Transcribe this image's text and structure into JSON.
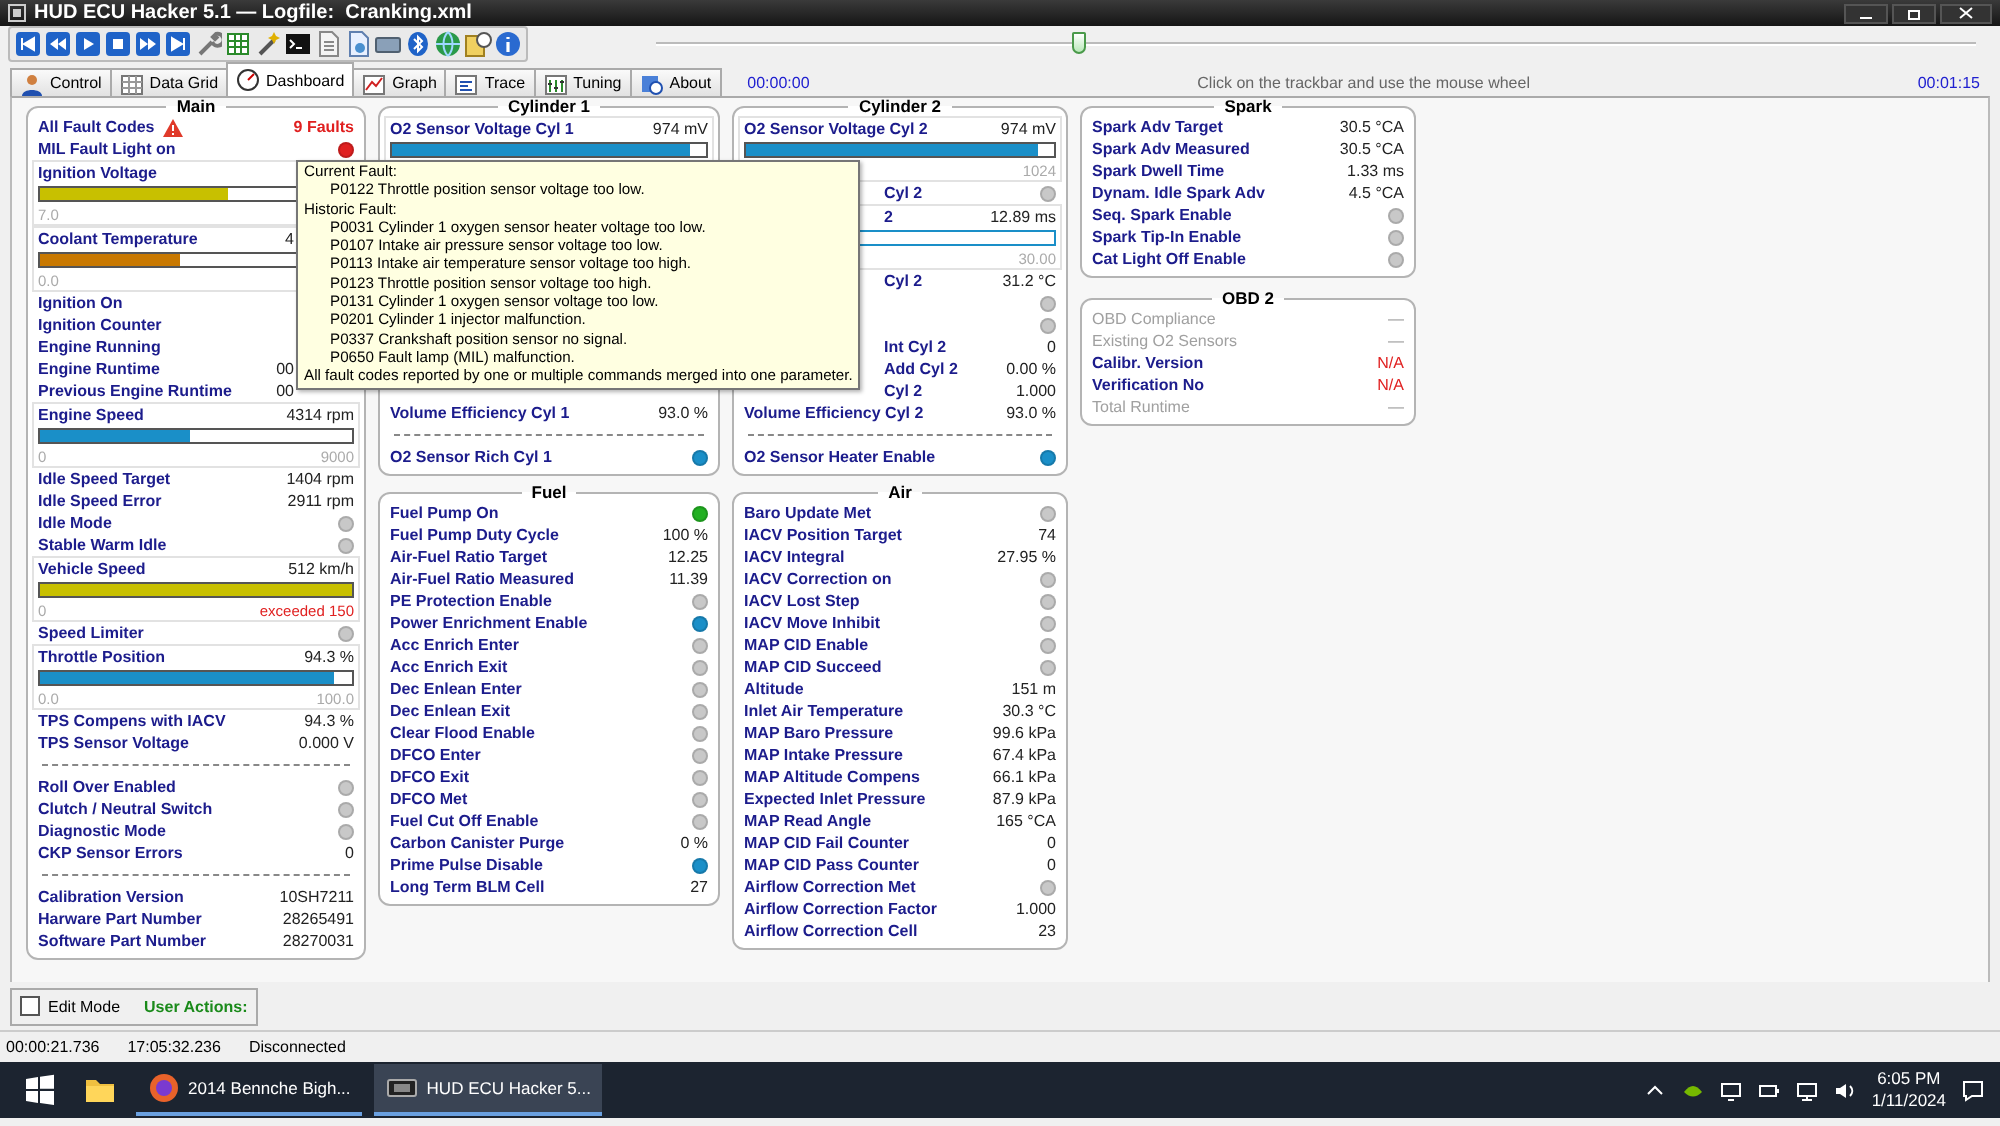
{
  "window": {
    "title": "HUD ECU Hacker 5.1 — Logfile:",
    "logfile": "Cranking.xml"
  },
  "trackbar": {
    "level": 0.32,
    "start": "00:00:00",
    "hint": "Click on the trackbar and use the mouse wheel",
    "end": "00:01:15"
  },
  "tabs": [
    {
      "label": "Control",
      "selected": false
    },
    {
      "label": "Data Grid",
      "selected": false
    },
    {
      "label": "Dashboard",
      "selected": true
    },
    {
      "label": "Graph",
      "selected": false
    },
    {
      "label": "Trace",
      "selected": false
    },
    {
      "label": "Tuning",
      "selected": false
    },
    {
      "label": "About",
      "selected": false
    }
  ],
  "main": {
    "title": "Main",
    "rows": [
      {
        "kind": "fault",
        "label": "All Fault Codes",
        "value": "9 Faults",
        "alert": true
      },
      {
        "kind": "light",
        "label": "MIL Fault Light on",
        "color": "#e02020"
      },
      {
        "kind": "bar",
        "label": "Ignition Voltage",
        "level": 0.6,
        "color": "#c8c000",
        "min": "7.0"
      },
      {
        "kind": "bar",
        "label": "Coolant Temperature",
        "value_head": "4",
        "level": 0.45,
        "color": "#c87800",
        "min": "0.0"
      },
      {
        "kind": "label",
        "label": "Ignition On"
      },
      {
        "kind": "label",
        "label": "Ignition Counter"
      },
      {
        "kind": "label",
        "label": "Engine Running"
      },
      {
        "kind": "value",
        "label": "Engine Runtime",
        "value_head": "00"
      },
      {
        "kind": "value",
        "label": "Previous Engine Runtime",
        "value_head": "00"
      },
      {
        "kind": "bar",
        "label": "Engine Speed",
        "value": "4314 rpm",
        "level": 0.48,
        "color": "#1a8fc8",
        "min": "0",
        "max": "9000"
      },
      {
        "kind": "value",
        "label": "Idle Speed Target",
        "value": "1404 rpm"
      },
      {
        "kind": "value",
        "label": "Idle Speed Error",
        "value": "2911 rpm"
      },
      {
        "kind": "light",
        "label": "Idle Mode",
        "color": "#c8c8c8"
      },
      {
        "kind": "light",
        "label": "Stable Warm Idle",
        "color": "#c8c8c8"
      },
      {
        "kind": "bar",
        "label": "Vehicle Speed",
        "value": "512 km/h",
        "level": 1,
        "color": "#c8c000",
        "min": "0",
        "max": "exceeded 150",
        "max_alert": true
      },
      {
        "kind": "light",
        "label": "Speed Limiter",
        "color": "#c8c8c8"
      },
      {
        "kind": "bar",
        "label": "Throttle Position",
        "value": "94.3 %",
        "level": 0.943,
        "color": "#1a8fc8",
        "min": "0.0",
        "max": "100.0"
      },
      {
        "kind": "value",
        "label": "TPS Compens with IACV",
        "value": "94.3 %"
      },
      {
        "kind": "value",
        "label": "TPS Sensor Voltage",
        "value": "0.000 V"
      },
      {
        "kind": "separator"
      },
      {
        "kind": "light",
        "label": "Roll Over Enabled",
        "color": "#c8c8c8"
      },
      {
        "kind": "light",
        "label": "Clutch / Neutral Switch",
        "color": "#c8c8c8"
      },
      {
        "kind": "light",
        "label": "Diagnostic Mode",
        "color": "#c8c8c8"
      },
      {
        "kind": "value",
        "label": "CKP Sensor Errors",
        "value": "0"
      },
      {
        "kind": "separator"
      },
      {
        "kind": "value",
        "label": "Calibration Version",
        "value": "10SH7211"
      },
      {
        "kind": "value",
        "label": "Harware Part Number",
        "value": "28265491"
      },
      {
        "kind": "value",
        "label": "Software Part Number",
        "value": "28270031"
      }
    ]
  },
  "cylinder_1": {
    "title": "Cylinder 1",
    "rows": [
      {
        "kind": "bar",
        "label": "O2 Sensor Voltage Cyl 1",
        "value": "974 mV",
        "level": 0.95,
        "color": "#1a8fc8"
      },
      {
        "kind": "value",
        "label": "Volume Efficiency Cyl 1",
        "value": "93.0 %"
      },
      {
        "kind": "separator"
      },
      {
        "kind": "light",
        "label": "O2 Sensor Rich Cyl 1",
        "color": "#1a8fc8"
      }
    ]
  },
  "cylinder_2": {
    "title": "Cylinder 2",
    "rows": [
      {
        "kind": "bar",
        "label": "O2 Sensor Voltage Cyl 2",
        "value": "974 mV",
        "level": 0.95,
        "color": "#1a8fc8",
        "max": "1024"
      },
      {
        "kind": "light",
        "label_tail": "Cyl 2",
        "color": "#c8c8c8"
      },
      {
        "kind": "bar",
        "label_tail": "2",
        "value": "12.89 ms",
        "color": "#1a8fc8",
        "max": "30.00"
      },
      {
        "kind": "value",
        "label_tail": "Cyl 2",
        "value": "31.2 °C"
      },
      {
        "kind": "light",
        "color": "#c8c8c8"
      },
      {
        "kind": "light",
        "color": "#c8c8c8"
      },
      {
        "kind": "value",
        "label_tail": "Int Cyl 2",
        "value": "0"
      },
      {
        "kind": "value",
        "label_tail": "Add Cyl 2",
        "value": "0.00 %"
      },
      {
        "kind": "value",
        "label_tail": "Cyl 2",
        "value": "1.000"
      },
      {
        "kind": "value",
        "label": "Volume Efficiency Cyl 2",
        "value": "93.0 %"
      },
      {
        "kind": "separator"
      },
      {
        "kind": "light",
        "label": "O2 Sensor Heater Enable",
        "color": "#1a8fc8"
      }
    ]
  },
  "fuel": {
    "title": "Fuel",
    "rows": [
      {
        "kind": "light",
        "label": "Fuel Pump On",
        "color": "#22b022"
      },
      {
        "kind": "value",
        "label": "Fuel Pump Duty Cycle",
        "value": "100 %"
      },
      {
        "kind": "value",
        "label": "Air-Fuel Ratio Target",
        "value": "12.25"
      },
      {
        "kind": "value",
        "label": "Air-Fuel Ratio Measured",
        "value": "11.39"
      },
      {
        "kind": "light",
        "label": "PE Protection Enable",
        "color": "#c8c8c8"
      },
      {
        "kind": "light",
        "label": "Power Enrichment Enable",
        "color": "#1a8fc8"
      },
      {
        "kind": "light",
        "label": "Acc Enrich Enter",
        "color": "#c8c8c8"
      },
      {
        "kind": "light",
        "label": "Acc Enrich Exit",
        "color": "#c8c8c8"
      },
      {
        "kind": "light",
        "label": "Dec Enlean Enter",
        "color": "#c8c8c8"
      },
      {
        "kind": "light",
        "label": "Dec Enlean Exit",
        "color": "#c8c8c8"
      },
      {
        "kind": "light",
        "label": "Clear Flood Enable",
        "color": "#c8c8c8"
      },
      {
        "kind": "light",
        "label": "DFCO Enter",
        "color": "#c8c8c8"
      },
      {
        "kind": "light",
        "label": "DFCO Exit",
        "color": "#c8c8c8"
      },
      {
        "kind": "light",
        "label": "DFCO Met",
        "color": "#c8c8c8"
      },
      {
        "kind": "light",
        "label": "Fuel Cut Off Enable",
        "color": "#c8c8c8"
      },
      {
        "kind": "value",
        "label": "Carbon Canister Purge",
        "value": "0 %"
      },
      {
        "kind": "light",
        "label": "Prime Pulse Disable",
        "color": "#1a8fc8"
      },
      {
        "kind": "value",
        "label": "Long Term BLM Cell",
        "value": "27"
      }
    ]
  },
  "air": {
    "title": "Air",
    "rows": [
      {
        "kind": "light",
        "label": "Baro Update Met",
        "color": "#c8c8c8"
      },
      {
        "kind": "value",
        "label": "IACV Position Target",
        "value": "74"
      },
      {
        "kind": "value",
        "label": "IACV Integral",
        "value": "27.95 %"
      },
      {
        "kind": "light",
        "label": "IACV Correction on",
        "color": "#c8c8c8"
      },
      {
        "kind": "light",
        "label": "IACV Lost Step",
        "color": "#c8c8c8"
      },
      {
        "kind": "light",
        "label": "IACV Move Inhibit",
        "color": "#c8c8c8"
      },
      {
        "kind": "light",
        "label": "MAP CID Enable",
        "color": "#c8c8c8"
      },
      {
        "kind": "light",
        "label": "MAP CID Succeed",
        "color": "#c8c8c8"
      },
      {
        "kind": "value",
        "label": "Altitude",
        "value": "151 m"
      },
      {
        "kind": "value",
        "label": "Inlet Air Temperature",
        "value": "30.3 °C"
      },
      {
        "kind": "value",
        "label": "MAP Baro Pressure",
        "value": "99.6 kPa"
      },
      {
        "kind": "value",
        "label": "MAP Intake Pressure",
        "value": "67.4 kPa"
      },
      {
        "kind": "value",
        "label": "MAP Altitude Compens",
        "value": "66.1 kPa"
      },
      {
        "kind": "value",
        "label": "Expected Inlet Pressure",
        "value": "87.9 kPa"
      },
      {
        "kind": "value",
        "label": "MAP Read Angle",
        "value": "165 °CA"
      },
      {
        "kind": "value",
        "label": "MAP CID Fail Counter",
        "value": "0"
      },
      {
        "kind": "value",
        "label": "MAP CID Pass Counter",
        "value": "0"
      },
      {
        "kind": "light",
        "label": "Airflow Correction Met",
        "color": "#c8c8c8"
      },
      {
        "kind": "value",
        "label": "Airflow Correction Factor",
        "value": "1.000"
      },
      {
        "kind": "value",
        "label": "Airflow Correction Cell",
        "value": "23"
      }
    ]
  },
  "spark": {
    "title": "Spark",
    "rows": [
      {
        "kind": "value",
        "label": "Spark Adv Target",
        "value": "30.5 °CA"
      },
      {
        "kind": "value",
        "label": "Spark Adv Measured",
        "value": "30.5 °CA"
      },
      {
        "kind": "value",
        "label": "Spark Dwell Time",
        "value": "1.33 ms"
      },
      {
        "kind": "value",
        "label": "Dynam. Idle Spark Adv",
        "value": "4.5 °CA"
      },
      {
        "kind": "light",
        "label": "Seq. Spark Enable",
        "color": "#c8c8c8"
      },
      {
        "kind": "light",
        "label": "Spark Tip-In Enable",
        "color": "#c8c8c8"
      },
      {
        "kind": "light",
        "label": "Cat Light Off Enable",
        "color": "#c8c8c8"
      }
    ]
  },
  "obd2": {
    "title": "OBD 2",
    "rows": [
      {
        "kind": "value",
        "label": "OBD Compliance",
        "value": "—",
        "disabled": true
      },
      {
        "kind": "value",
        "label": "Existing O2 Sensors",
        "value": "—",
        "disabled": true
      },
      {
        "kind": "value",
        "label": "Calibr. Version",
        "value": "N/A",
        "disabled": false,
        "alert": true
      },
      {
        "kind": "value",
        "label": "Verification No",
        "value": "N/A",
        "disabled": false,
        "alert": true
      },
      {
        "kind": "value",
        "label": "Total Runtime",
        "value": "—",
        "disabled": true
      }
    ]
  },
  "tooltip": {
    "current_heading": "Current Fault:",
    "current": [
      "P0122 Throttle position sensor voltage too low."
    ],
    "historic_heading": "Historic Fault:",
    "historic": [
      "P0031 Cylinder 1 oxygen sensor heater voltage too low.",
      "P0107 Intake air pressure sensor voltage too low.",
      "P0113 Intake air temperature sensor voltage too high.",
      "P0123 Throttle position sensor voltage too high.",
      "P0131 Cylinder 1 oxygen sensor voltage too low.",
      "P0201 Cylinder 1 injector malfunction.",
      "P0337 Crankshaft position sensor no signal.",
      "P0650 Fault lamp (MIL) malfunction."
    ],
    "footer": "All fault codes reported by one or multiple commands merged into one parameter."
  },
  "edit_mode": {
    "label": "Edit Mode",
    "checked": false
  },
  "user_actions_label": "User Actions:",
  "status_bar": [
    "00:00:21.736",
    "17:05:32.236",
    "Disconnected"
  ],
  "taskbar": {
    "apps": [
      {
        "label": "2014 Bennche Bigh...",
        "selected": false
      },
      {
        "label": "HUD ECU Hacker 5...",
        "selected": true
      }
    ],
    "time": "6:05 PM",
    "date": "1/11/2024"
  }
}
